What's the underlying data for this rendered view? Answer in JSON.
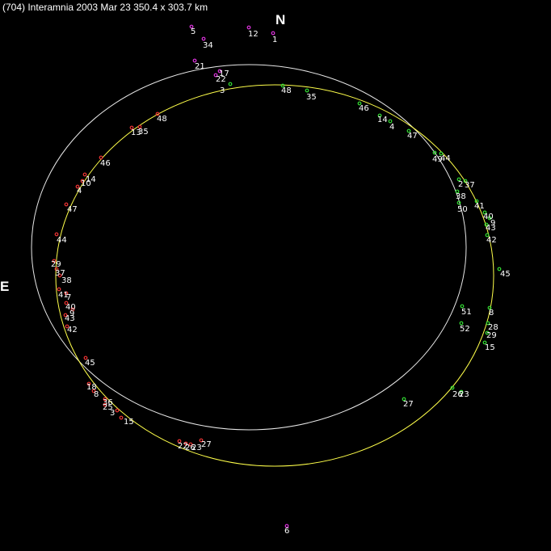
{
  "title": "(704) Interamnia   2003 Mar 23    350.4 x 303.7 km",
  "compass": {
    "north": "N",
    "east": "E"
  },
  "colors": {
    "background": "#000000",
    "text": "#ffffff",
    "outer_ellipse": "#e8e8e8",
    "inner_ellipse": "#ffff4a",
    "observer_green": "#33dd33",
    "observer_red": "#ee3333",
    "observer_magenta": "#dd33dd"
  },
  "observers": [
    {
      "id": "5",
      "color": "magenta"
    },
    {
      "id": "34",
      "color": "magenta"
    },
    {
      "id": "12",
      "color": "magenta"
    },
    {
      "id": "1",
      "color": "magenta"
    },
    {
      "id": "21",
      "color": "magenta"
    },
    {
      "id": "17",
      "color": "magenta"
    },
    {
      "id": "22",
      "color": "magenta"
    },
    {
      "id": "6",
      "color": "magenta"
    },
    {
      "id": "3",
      "color": "green"
    },
    {
      "id": "48",
      "color": "green"
    },
    {
      "id": "35",
      "color": "green"
    },
    {
      "id": "46",
      "color": "green"
    },
    {
      "id": "14",
      "color": "green"
    },
    {
      "id": "4",
      "color": "green"
    },
    {
      "id": "47",
      "color": "green"
    },
    {
      "id": "49",
      "color": "green"
    },
    {
      "id": "44",
      "color": "green"
    },
    {
      "id": "2",
      "color": "green"
    },
    {
      "id": "37",
      "color": "green"
    },
    {
      "id": "38",
      "color": "green"
    },
    {
      "id": "50",
      "color": "green"
    },
    {
      "id": "41",
      "color": "green"
    },
    {
      "id": "40",
      "color": "green"
    },
    {
      "id": "9",
      "color": "green"
    },
    {
      "id": "43",
      "color": "green"
    },
    {
      "id": "42",
      "color": "green"
    },
    {
      "id": "45",
      "color": "green"
    },
    {
      "id": "51",
      "color": "green"
    },
    {
      "id": "52",
      "color": "green"
    },
    {
      "id": "8",
      "color": "green"
    },
    {
      "id": "28",
      "color": "green"
    },
    {
      "id": "29",
      "color": "green"
    },
    {
      "id": "15",
      "color": "green"
    },
    {
      "id": "27",
      "color": "green"
    },
    {
      "id": "26",
      "color": "green"
    },
    {
      "id": "23",
      "color": "green"
    },
    {
      "id": "13",
      "color": "red"
    },
    {
      "id": "35",
      "color": "red"
    },
    {
      "id": "48",
      "color": "red"
    },
    {
      "id": "46",
      "color": "red"
    },
    {
      "id": "14",
      "color": "red"
    },
    {
      "id": "10",
      "color": "red"
    },
    {
      "id": "4",
      "color": "red"
    },
    {
      "id": "47",
      "color": "red"
    },
    {
      "id": "44",
      "color": "red"
    },
    {
      "id": "29",
      "color": "red"
    },
    {
      "id": "37",
      "color": "red"
    },
    {
      "id": "38",
      "color": "red"
    },
    {
      "id": "41",
      "color": "red"
    },
    {
      "id": "7",
      "color": "red"
    },
    {
      "id": "40",
      "color": "red"
    },
    {
      "id": "9",
      "color": "red"
    },
    {
      "id": "43",
      "color": "red"
    },
    {
      "id": "42",
      "color": "red"
    },
    {
      "id": "45",
      "color": "red"
    },
    {
      "id": "18",
      "color": "red"
    },
    {
      "id": "8",
      "color": "red"
    },
    {
      "id": "36",
      "color": "red"
    },
    {
      "id": "25",
      "color": "red"
    },
    {
      "id": "3",
      "color": "red"
    },
    {
      "id": "15",
      "color": "red"
    },
    {
      "id": "22",
      "color": "red"
    },
    {
      "id": "26",
      "color": "red"
    },
    {
      "id": "23",
      "color": "red"
    },
    {
      "id": "27",
      "color": "red"
    }
  ]
}
